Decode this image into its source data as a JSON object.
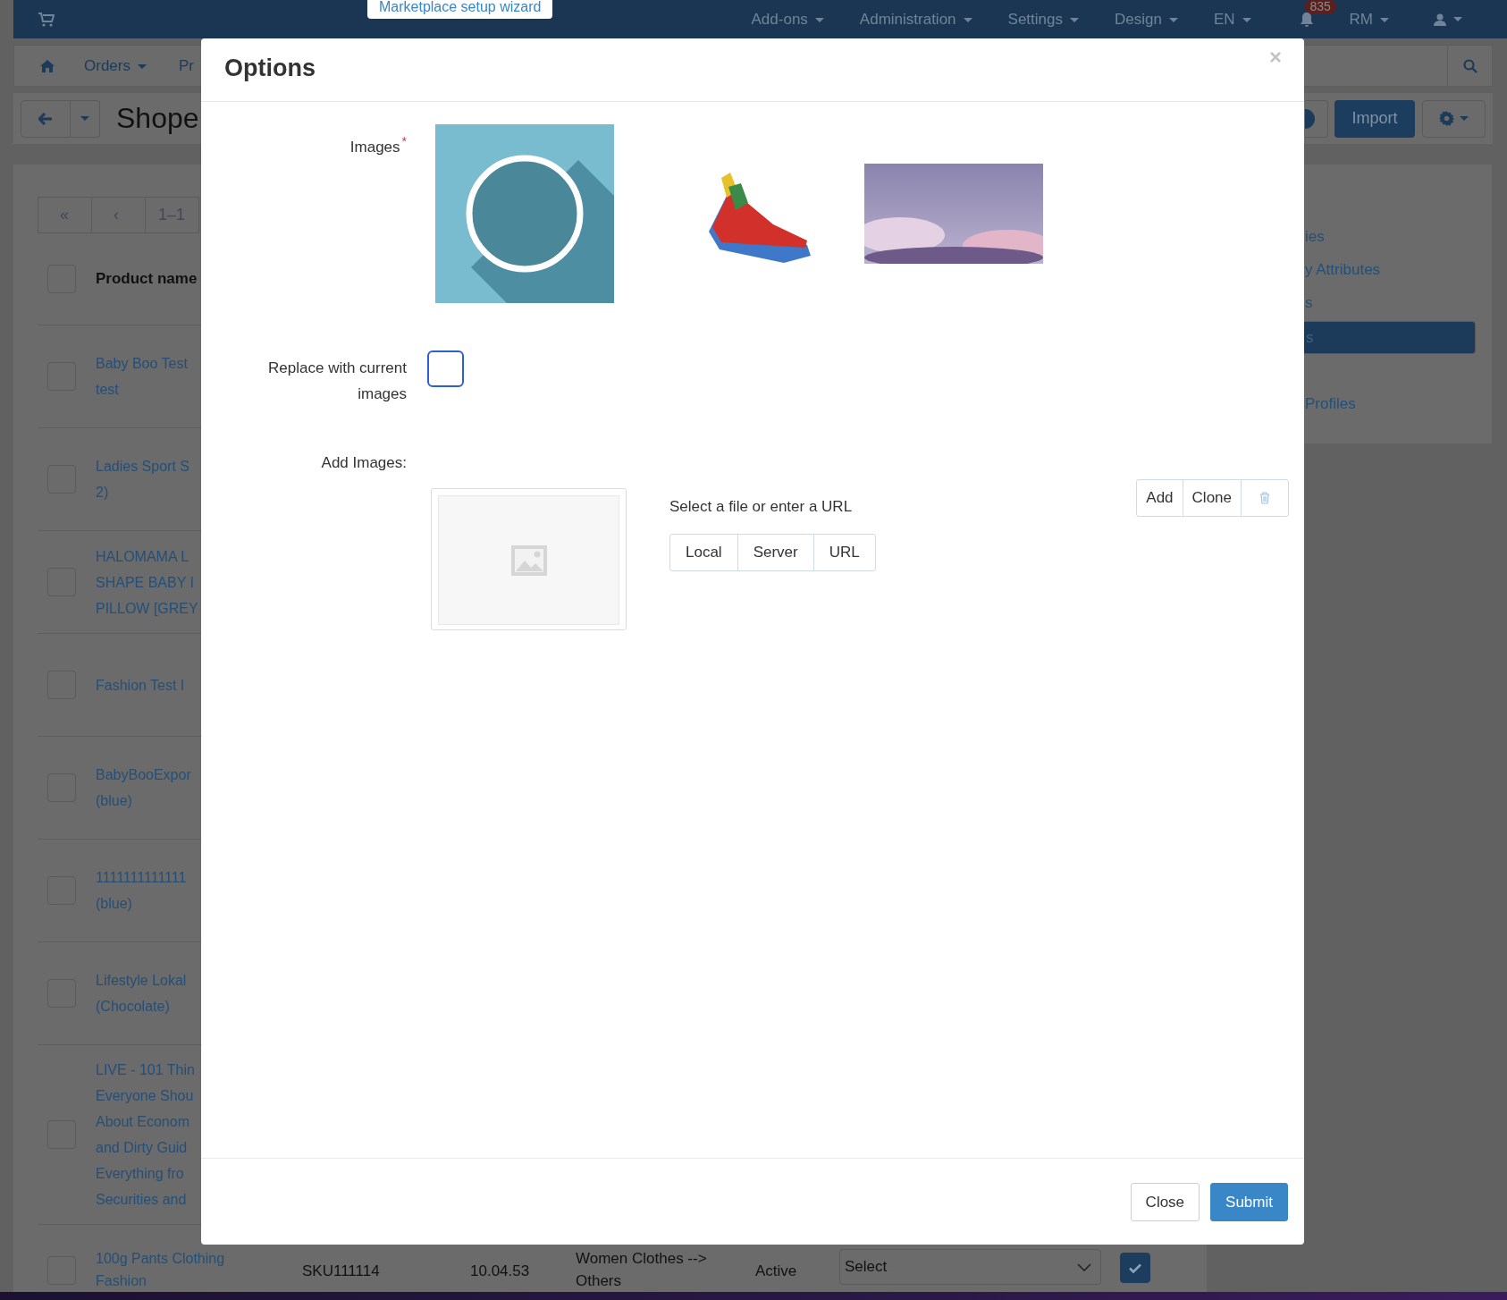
{
  "top_nav": {
    "wizard_link": "Marketplace setup wizard",
    "menus": [
      "Add-ons",
      "Administration",
      "Settings",
      "Design",
      "EN"
    ],
    "notification_count": "835",
    "user_menu": "RM"
  },
  "sub_nav": {
    "menus": [
      {
        "label": "Orders",
        "dropdown": true
      },
      {
        "label": "Pr",
        "dropdown": false
      }
    ]
  },
  "toolbar": {
    "title": "Shope",
    "import_button": "Import"
  },
  "pagination": [
    "«",
    "‹",
    "1–1"
  ],
  "table": {
    "header": {
      "label": "Product name",
      "checked": false
    },
    "rows": [
      {
        "name_lines": [
          "Baby Boo Test",
          "test"
        ],
        "checked": false
      },
      {
        "name_lines": [
          "Ladies Sport S",
          "2)"
        ],
        "checked": false
      },
      {
        "name_lines": [
          "HALOMAMA L",
          "SHAPE BABY I",
          "PILLOW [GREY"
        ],
        "checked": false
      },
      {
        "name_lines": [
          "Fashion Test I"
        ],
        "checked": false
      },
      {
        "name_lines": [
          "BabyBooExpor",
          "(blue)"
        ],
        "checked": false
      },
      {
        "name_lines": [
          "1111111111111",
          "(blue)"
        ],
        "checked": false
      },
      {
        "name_lines": [
          "Lifestyle Lokal",
          "(Chocolate)"
        ],
        "checked": false
      },
      {
        "name_lines": [
          "LIVE - 101 Thin",
          "Everyone Shou",
          "About Econom",
          "and Dirty Guid",
          "Everything fro",
          "Securities and"
        ],
        "checked": false
      }
    ],
    "last_row": {
      "name_lines": [
        "100g Pants Clothing",
        "Fashion"
      ],
      "checked": false,
      "sku": "SKU111114",
      "time": "10.04.53",
      "category_lines": [
        "Women Clothes -->",
        "Others"
      ],
      "status": "Active",
      "select": "Select",
      "enabled": true
    }
  },
  "sidebar": {
    "items": [
      {
        "label": "ies",
        "selected": false
      },
      {
        "label": "y Attributes",
        "selected": false
      },
      {
        "label": "s",
        "selected": false
      },
      {
        "label": "s",
        "selected": true
      },
      {
        "label": "Profiles",
        "selected": false
      }
    ]
  },
  "modal": {
    "title": "Options",
    "close": "×",
    "images_label": "Images",
    "required_mark": "*",
    "images": [
      {
        "kind": "badge"
      },
      {
        "kind": "shoe"
      },
      {
        "kind": "clouds"
      }
    ],
    "replace_label": "Replace with current images",
    "replace_checked": false,
    "add_images_label": "Add Images:",
    "upload_hint": "Select a file or enter a URL",
    "source_buttons": [
      "Local",
      "Server",
      "URL"
    ],
    "row_actions": [
      "Add",
      "Clone"
    ],
    "footer_buttons": [
      {
        "label": "Close",
        "kind": "default"
      },
      {
        "label": "Submit",
        "kind": "primary"
      }
    ]
  }
}
